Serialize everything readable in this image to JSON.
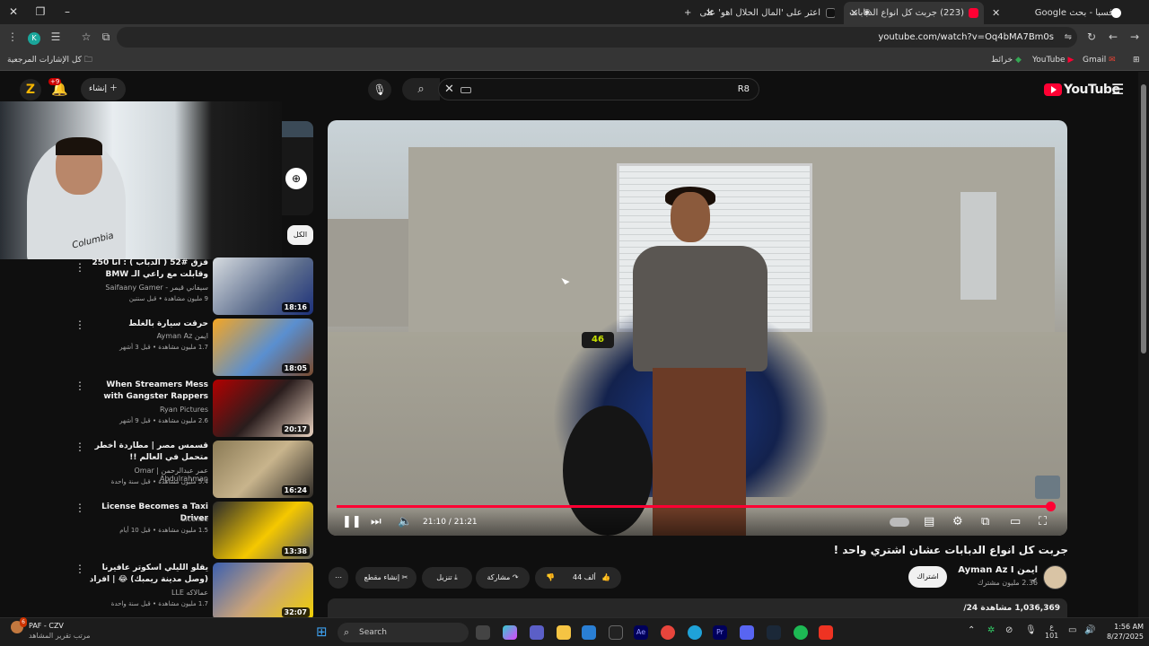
{
  "browser": {
    "tabs": [
      {
        "label": "فسبا - بحث Google",
        "active": false
      },
      {
        "label": "(223) جربت كل انواع الدبابات",
        "active": true
      },
      {
        "label": "اعثر على 'المال الحلال اهو' على",
        "active": false
      }
    ],
    "new_tab": "+",
    "url": "youtube.com/watch?v=Oq4bMA7Bm0s",
    "bookmarks": [
      {
        "label": "Gmail"
      },
      {
        "label": "YouTube"
      },
      {
        "label": "خرائط"
      }
    ],
    "all_bookmarks": "كل الإشارات المرجعية",
    "profile_initial": "K"
  },
  "youtube": {
    "logo": "YouTube",
    "search_value": "",
    "search_left_hint": "R8",
    "create_label": "إنشاء",
    "notif_badge": "+9",
    "channel_initial": "Z",
    "chip_all": "الكل"
  },
  "player": {
    "time_current": "21:10",
    "time_total": "21:21",
    "time_label": "21:10 / 21:21",
    "progress": 0.991,
    "bike_number": "46"
  },
  "video": {
    "title": "جربت كل انواع الدبابات عشان اشتري واحد !",
    "channel": "ايمن Ayman Az I",
    "subscribers": "2.36 مليون مشترك",
    "subscribe_label": "اشتراك",
    "likes": "44 ألف",
    "share_label": "مشاركة",
    "download_label": "تنزيل",
    "clip_label": "إنشاء مقطع",
    "views": "1,036,369 مشاهدة",
    "desc_extra": "24/"
  },
  "recommendations": [
    {
      "title": "فزق #52 ( الدباب ) : انا 250 وقابلت مع راعي الـ BMW 1000 + صارع + شروق...",
      "channel": "سيفاني قيمر - Saifaany Gamer",
      "views": "9 مليون مشاهدة • قبل سنتين",
      "duration": "18:16"
    },
    {
      "title": "حرقت سيارة بالغلط",
      "channel": "ايمن Ayman Az",
      "views": "1.7 مليون مشاهدة • قبل 3 أشهر",
      "duration": "18:05"
    },
    {
      "title": "When Streamers Mess with Gangster Rappers",
      "channel": "Ryan Pictures",
      "views": "2.6 مليون مشاهدة • قبل 9 أشهر",
      "duration": "20:17"
    },
    {
      "title": "قسمس مصر | مطاردة أخطر متحمل في العالم !!",
      "channel": "عمر عبدالرحمن | Omar Abdulrahman",
      "views": "5.4 مليون مشاهدة • قبل سنة واحدة",
      "duration": "16:24"
    },
    {
      "title": "License Becomes a Taxi Driver",
      "channel": "License",
      "views": "1.5 مليون مشاهدة • قبل 10 أيام",
      "duration": "13:38"
    },
    {
      "title": "يقلو الليلي اسكوتر عافيرنا (وصل مدينة ريمبك) 😂 | افراد الحياة الواقعي...",
      "channel": "عمالاكه LLE",
      "views": "1.7 مليون مشاهدة • قبل سنة واحدة",
      "duration": "32:07"
    }
  ],
  "taskbar": {
    "weather_title": "PAF - CZV",
    "weather_sub": "مرتب تقرير المشاهد",
    "search_placeholder": "Search",
    "time": "1:56 AM",
    "date": "8/27/2025",
    "lang": "ع",
    "lang_num": "101",
    "notif_count": "6"
  }
}
